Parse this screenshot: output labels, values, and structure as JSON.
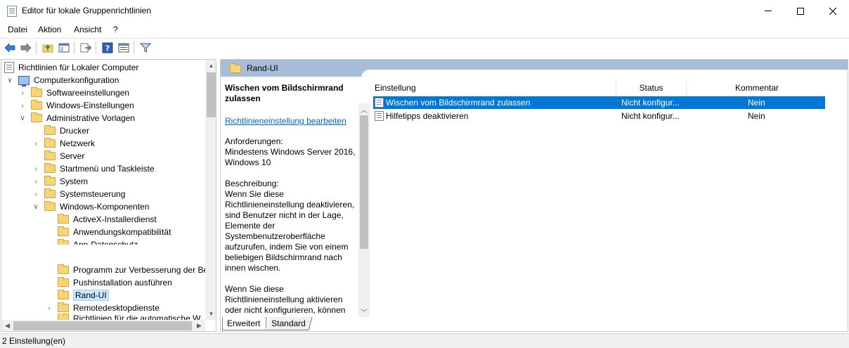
{
  "window": {
    "title": "Editor für lokale Gruppenrichtlinien",
    "minimize": "—",
    "maximize": "☐",
    "close": "✕"
  },
  "menu": {
    "file": "Datei",
    "action": "Aktion",
    "view": "Ansicht",
    "help": "?"
  },
  "toolbar": {
    "icons": [
      "back-arrow-icon",
      "forward-arrow-icon",
      "up-folder-icon",
      "show-hide-tree-icon",
      "export-list-icon",
      "help-icon",
      "extended-view-icon",
      "filter-icon"
    ]
  },
  "tree": {
    "root": "Richtlinien für Lokaler Computer",
    "computer_config": "Computerkonfiguration",
    "software": "Softwareeinstellungen",
    "windows_settings": "Windows-Einstellungen",
    "admin_templates": "Administrative Vorlagen",
    "printers": "Drucker",
    "network": "Netzwerk",
    "server": "Server",
    "start_menu": "Startmenü und Taskleiste",
    "system": "System",
    "control_panel": "Systemsteuerung",
    "windows_components": "Windows-Komponenten",
    "activex": "ActiveX-Installerdienst",
    "app_compat": "Anwendungskompatibilität",
    "app_privacy": "App-Datenschutz",
    "ceip": "Programm zur Verbesserung der Ber",
    "push_install": "Pushinstallation ausführen",
    "edge_ui": "Rand-UI",
    "remote_desktop": "Remotedesktopdienste",
    "more": "Richtlinien für die automatische W"
  },
  "right_pane": {
    "header_title": "Rand-UI",
    "description": {
      "title": "Wischen vom Bildschirmrand zulassen",
      "link": "Richtlinieneinstellung bearbeiten",
      "requirements_label": "Anforderungen:",
      "requirements_value": "Mindestens Windows Server 2016, Windows 10",
      "description_label": "Beschreibung:",
      "paragraph1": "Wenn Sie diese Richtlinieneinstellung deaktivieren, sind Benutzer nicht in der Lage, Elemente der Systembenutzeroberfläche aufzurufen, indem Sie von einem beliebigen Bildschirmrand nach innen wischen.",
      "paragraph2": "Wenn Sie diese Richtlinieneinstellung aktivieren oder nicht konfigurieren, können"
    },
    "columns": {
      "setting": "Einstellung",
      "status": "Status",
      "comment": "Kommentar"
    },
    "rows": [
      {
        "setting": "Wischen vom Bildschirmrand zulassen",
        "status": "Nicht konfigur...",
        "comment": "Nein"
      },
      {
        "setting": "Hilfetipps deaktivieren",
        "status": "Nicht konfigur...",
        "comment": "Nein"
      }
    ],
    "tabs": {
      "extended": "Erweitert",
      "standard": "Standard"
    }
  },
  "status_bar": {
    "text": "2 Einstellung(en)"
  }
}
